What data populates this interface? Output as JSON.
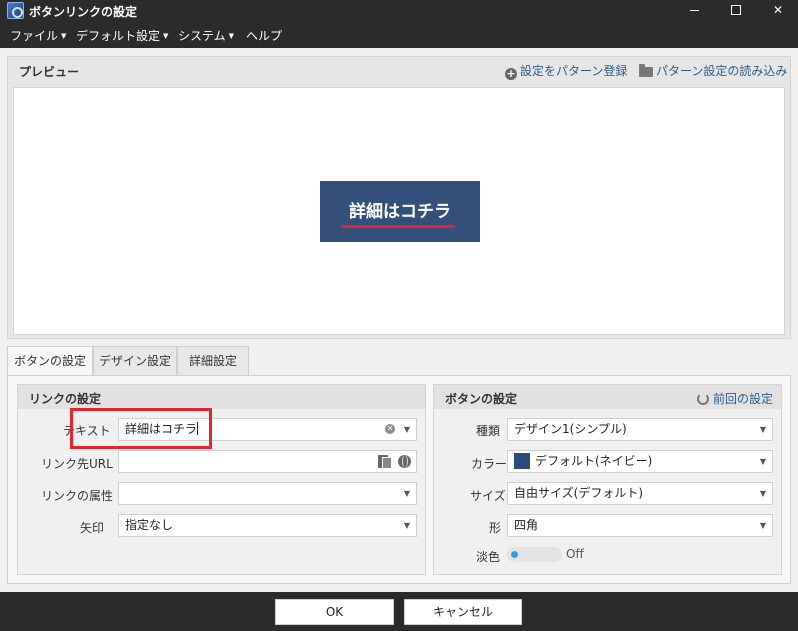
{
  "window": {
    "title": "ボタンリンクの設定",
    "controls": [
      "minimize-icon",
      "maximize-icon",
      "close-icon"
    ]
  },
  "menu": {
    "items": [
      {
        "label": "ファイル"
      },
      {
        "label": "デフォルト設定"
      },
      {
        "label": "システム"
      },
      {
        "label": "ヘルプ"
      }
    ]
  },
  "preview": {
    "label": "プレビュー",
    "save_pattern": "設定をパターン登録",
    "load_pattern": "パターン設定の読み込み",
    "button_text": "詳細はコチラ",
    "button_color": "#33507a",
    "annotation_color": "#e8232e"
  },
  "tabs": [
    {
      "label": "ボタンの設定",
      "active": true
    },
    {
      "label": "デザイン設定",
      "active": false
    },
    {
      "label": "詳細設定",
      "active": false
    }
  ],
  "link_settings": {
    "title": "リンクの設定",
    "text_label": "テキスト",
    "text_value": "詳細はコチラ",
    "url_label": "リンク先URL",
    "url_value": "",
    "attr_label": "リンクの属性",
    "attr_value": "",
    "arrow_label": "矢印",
    "arrow_value": "指定なし"
  },
  "button_settings": {
    "title": "ボタンの設定",
    "prev_settings": "前回の設定",
    "type_label": "種類",
    "type_value": "デザイン1(シンプル)",
    "color_label": "カラー",
    "color_value": "デフォルト(ネイビー)",
    "color_swatch": "#2b4c78",
    "size_label": "サイズ",
    "size_value": "自由サイズ(デフォルト)",
    "shape_label": "形",
    "shape_value": "四角",
    "fade_label": "淡色",
    "fade_state": "Off"
  },
  "footer": {
    "ok": "OK",
    "cancel": "キャンセル"
  }
}
